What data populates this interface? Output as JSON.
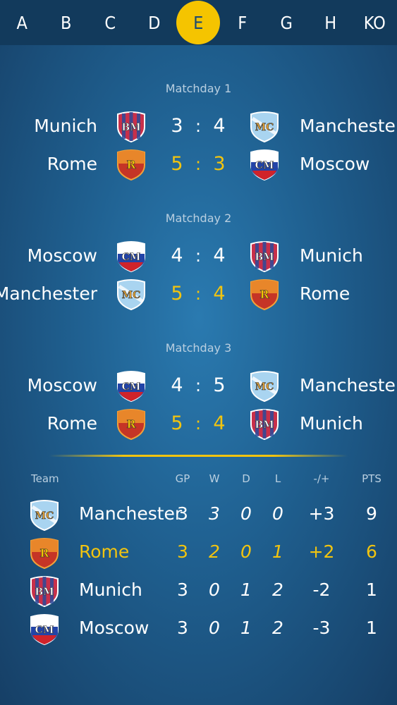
{
  "tabs": [
    "A",
    "B",
    "C",
    "D",
    "E",
    "F",
    "G",
    "H",
    "KO"
  ],
  "active_tab": "E",
  "matchdays": [
    {
      "title": "Matchday 1",
      "matches": [
        {
          "home": "Munich",
          "home_badge": "BM",
          "s1": "3",
          "s2": "4",
          "away": "Manchester",
          "away_badge": "MC",
          "highlight": false
        },
        {
          "home": "Rome",
          "home_badge": "R",
          "s1": "5",
          "s2": "3",
          "away": "Moscow",
          "away_badge": "CM",
          "highlight": true
        }
      ]
    },
    {
      "title": "Matchday 2",
      "matches": [
        {
          "home": "Moscow",
          "home_badge": "CM",
          "s1": "4",
          "s2": "4",
          "away": "Munich",
          "away_badge": "BM",
          "highlight": false
        },
        {
          "home": "Manchester",
          "home_badge": "MC",
          "s1": "5",
          "s2": "4",
          "away": "Rome",
          "away_badge": "R",
          "highlight": true
        }
      ]
    },
    {
      "title": "Matchday 3",
      "matches": [
        {
          "home": "Moscow",
          "home_badge": "CM",
          "s1": "4",
          "s2": "5",
          "away": "Manchester",
          "away_badge": "MC",
          "highlight": false
        },
        {
          "home": "Rome",
          "home_badge": "R",
          "s1": "5",
          "s2": "4",
          "away": "Munich",
          "away_badge": "BM",
          "highlight": true
        }
      ]
    }
  ],
  "colon": ":",
  "table": {
    "headers": {
      "team": "Team",
      "gp": "GP",
      "w": "W",
      "d": "D",
      "l": "L",
      "gd": "-/+",
      "pts": "PTS"
    },
    "rows": [
      {
        "team": "Manchester",
        "badge": "MC",
        "gp": "3",
        "w": "3",
        "d": "0",
        "l": "0",
        "gd": "+3",
        "pts": "9",
        "highlight": false
      },
      {
        "team": "Rome",
        "badge": "R",
        "gp": "3",
        "w": "2",
        "d": "0",
        "l": "1",
        "gd": "+2",
        "pts": "6",
        "highlight": true
      },
      {
        "team": "Munich",
        "badge": "BM",
        "gp": "3",
        "w": "0",
        "d": "1",
        "l": "2",
        "gd": "-2",
        "pts": "1",
        "highlight": false
      },
      {
        "team": "Moscow",
        "badge": "CM",
        "gp": "3",
        "w": "0",
        "d": "1",
        "l": "2",
        "gd": "-3",
        "pts": "1",
        "highlight": false
      }
    ]
  },
  "colors": {
    "accent": "#f2c40f",
    "tab_active": "#f5c400",
    "text": "#ffffff",
    "muted": "#b9cfe0"
  }
}
